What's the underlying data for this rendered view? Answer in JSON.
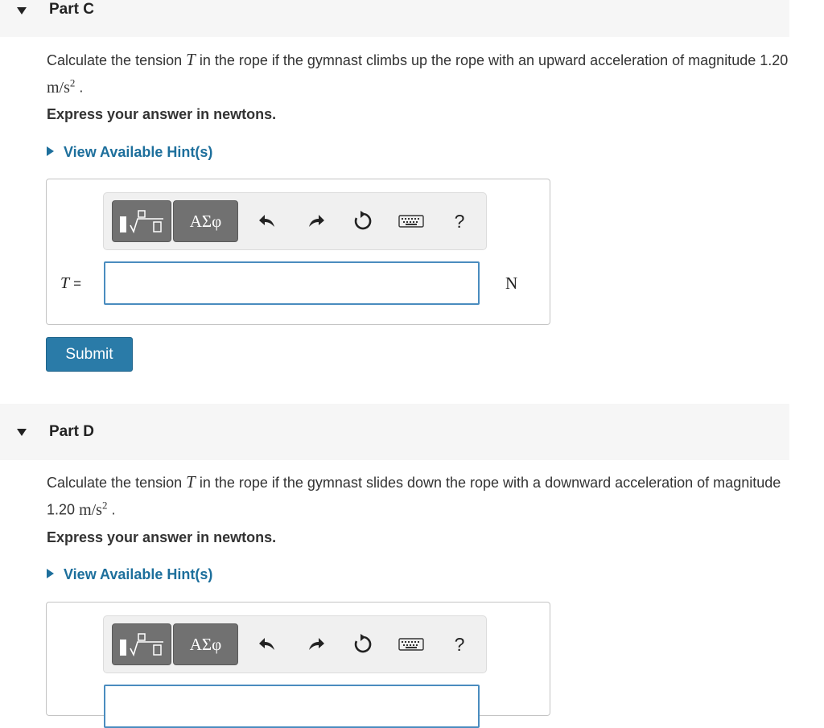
{
  "parts": [
    {
      "title": "Part C",
      "question_prefix": "Calculate the tension",
      "question_var": "T",
      "question_middle": "in the rope if the gymnast climbs up the rope with an upward acceleration of magnitude 1.20",
      "question_unit": "m/s",
      "question_exp": "2",
      "question_end": ".",
      "instruction": "Express your answer in newtons.",
      "hint": "View Available Hint(s)",
      "toolbar": {
        "symbols_label": "ΑΣφ",
        "help_label": "?"
      },
      "equation_var": "T",
      "equation_eq": "=",
      "input_value": "",
      "unit": "N",
      "submit_label": "Submit"
    },
    {
      "title": "Part D",
      "question_prefix": "Calculate the tension",
      "question_var": "T",
      "question_middle": "in the rope if the gymnast slides down the rope with a downward acceleration of magnitude 1.20",
      "question_unit": "m/s",
      "question_exp": "2",
      "question_end": ".",
      "instruction": "Express your answer in newtons.",
      "hint": "View Available Hint(s)",
      "toolbar": {
        "symbols_label": "ΑΣφ",
        "help_label": "?"
      }
    }
  ]
}
